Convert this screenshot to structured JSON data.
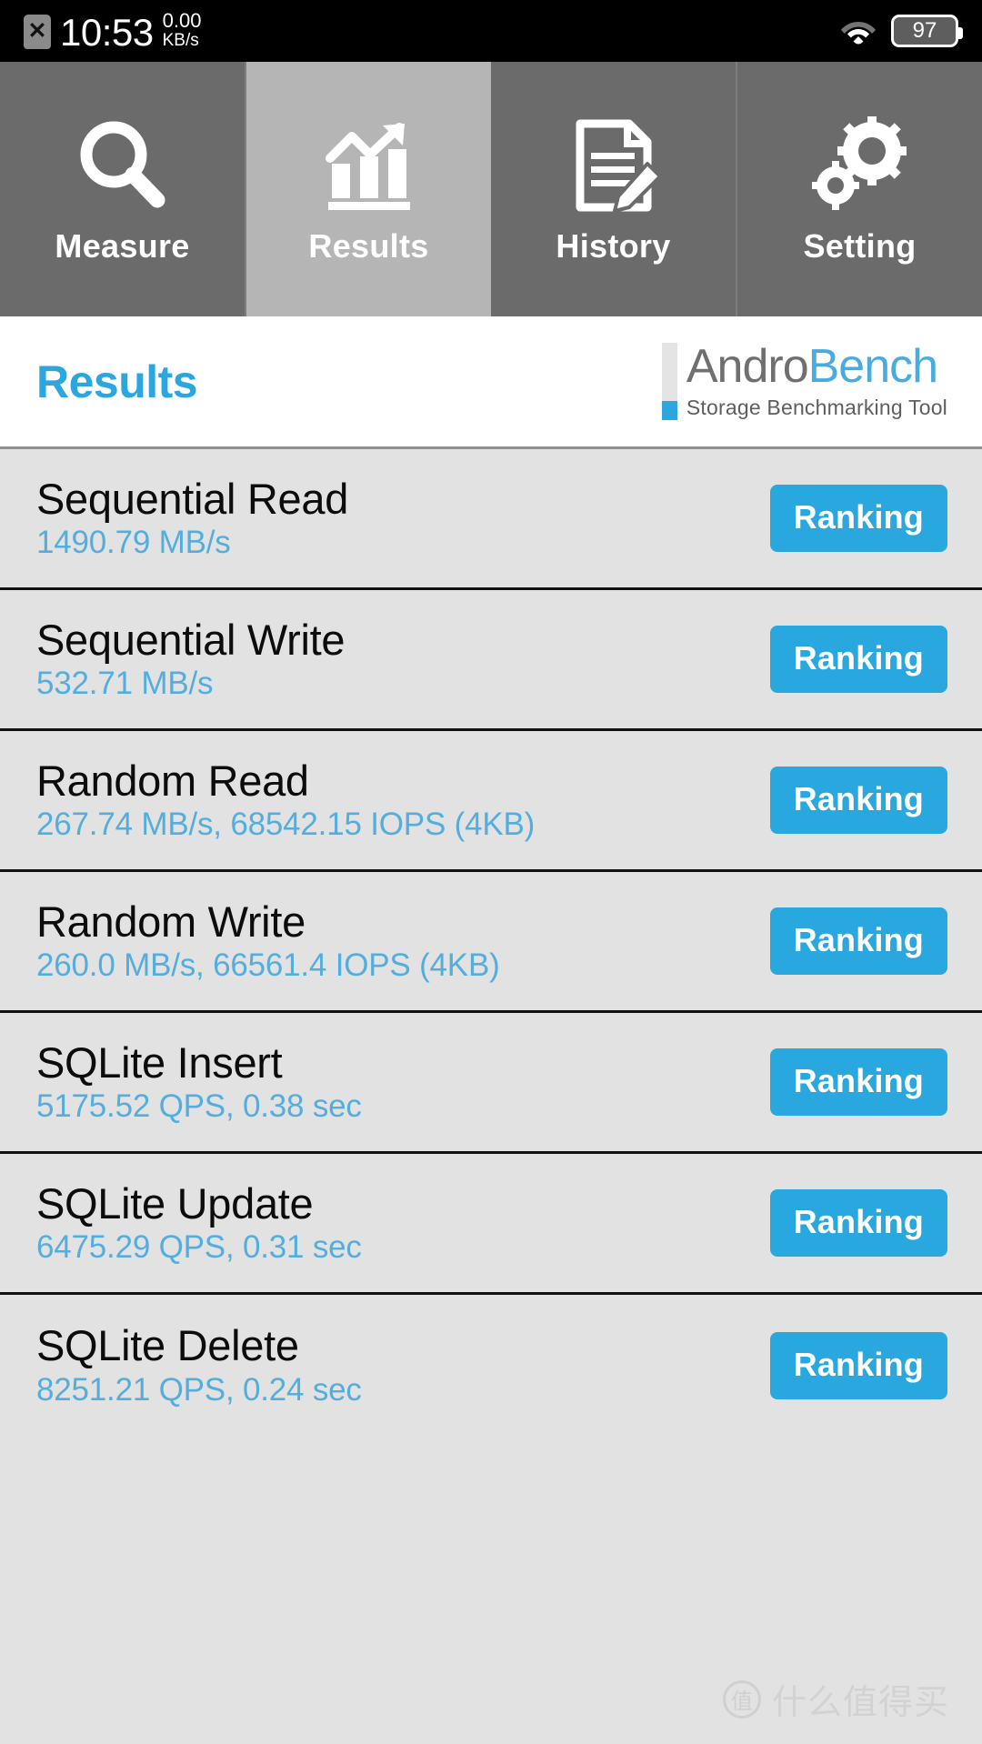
{
  "status_bar": {
    "sim_icon": "sim-card-off-icon",
    "sim_glyph": "✕",
    "time": "10:53",
    "net_speed_value": "0.00",
    "net_speed_unit": "KB/s",
    "wifi_icon": "wifi-icon",
    "battery_level": "97"
  },
  "tabs": [
    {
      "label": "Measure",
      "icon": "magnifier-icon",
      "active": false
    },
    {
      "label": "Results",
      "icon": "bar-chart-arrow-icon",
      "active": true
    },
    {
      "label": "History",
      "icon": "document-pencil-icon",
      "active": false
    },
    {
      "label": "Setting",
      "icon": "gears-icon",
      "active": false
    }
  ],
  "header": {
    "page_title": "Results",
    "brand_part1": "Andro",
    "brand_part2": "Bench",
    "brand_subtitle": "Storage Benchmarking Tool"
  },
  "results": [
    {
      "title": "Sequential Read",
      "value": "1490.79 MB/s",
      "button": "Ranking"
    },
    {
      "title": "Sequential Write",
      "value": "532.71 MB/s",
      "button": "Ranking"
    },
    {
      "title": "Random Read",
      "value": "267.74 MB/s, 68542.15 IOPS (4KB)",
      "button": "Ranking"
    },
    {
      "title": "Random Write",
      "value": "260.0 MB/s, 66561.4 IOPS (4KB)",
      "button": "Ranking"
    },
    {
      "title": "SQLite Insert",
      "value": "5175.52 QPS, 0.38 sec",
      "button": "Ranking"
    },
    {
      "title": "SQLite Update",
      "value": "6475.29 QPS, 0.31 sec",
      "button": "Ranking"
    },
    {
      "title": "SQLite Delete",
      "value": "8251.21 QPS, 0.24 sec",
      "button": "Ranking"
    }
  ],
  "watermark": {
    "logo_char": "值",
    "text": "什么值得买"
  },
  "colors": {
    "accent_blue": "#29a8e0",
    "value_blue": "#54aedd",
    "tab_inactive": "#6b6b6b",
    "tab_active": "#b5b5b5",
    "list_bg": "#e2e2e2"
  }
}
